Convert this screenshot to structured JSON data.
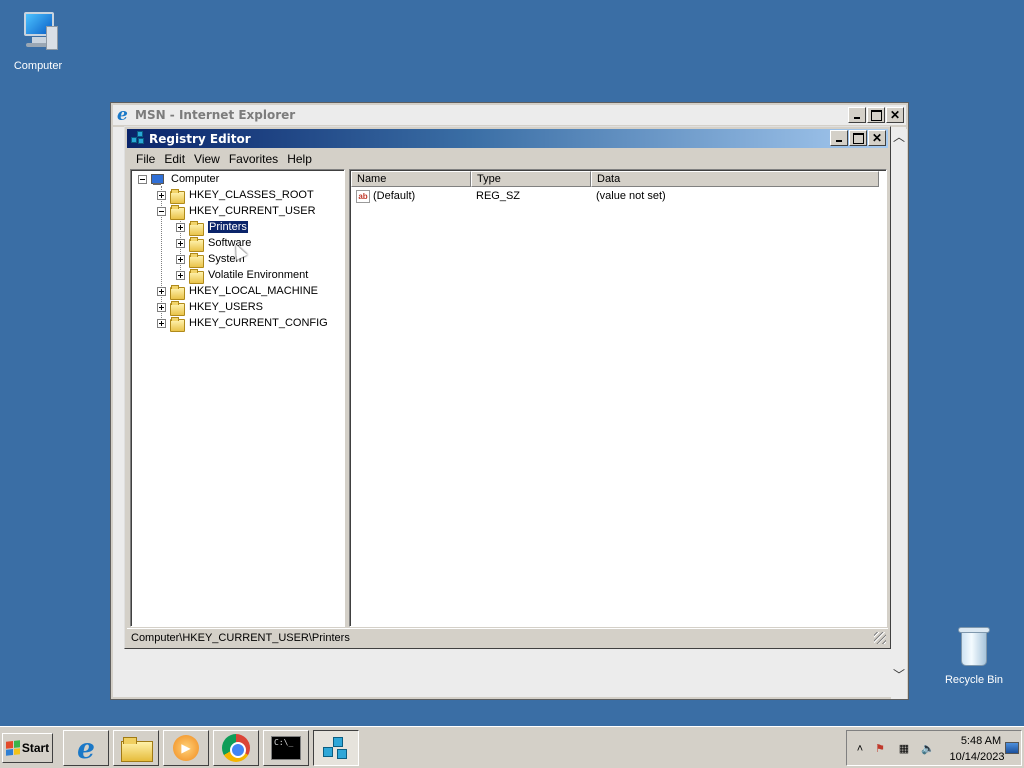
{
  "desktop": {
    "icons": [
      {
        "label": "Computer"
      },
      {
        "label": "Recycle Bin"
      }
    ]
  },
  "ie_window": {
    "title": "MSN - Internet Explorer",
    "icon": "ie-icon"
  },
  "regedit": {
    "title": "Registry Editor",
    "menu": [
      "File",
      "Edit",
      "View",
      "Favorites",
      "Help"
    ],
    "tree": {
      "root": "Computer",
      "keys": [
        {
          "label": "HKEY_CLASSES_ROOT",
          "expanded": false
        },
        {
          "label": "HKEY_CURRENT_USER",
          "expanded": true,
          "children": [
            {
              "label": "Printers",
              "selected": true
            },
            {
              "label": "Software"
            },
            {
              "label": "System"
            },
            {
              "label": "Volatile Environment"
            }
          ]
        },
        {
          "label": "HKEY_LOCAL_MACHINE",
          "expanded": false
        },
        {
          "label": "HKEY_USERS",
          "expanded": false
        },
        {
          "label": "HKEY_CURRENT_CONFIG",
          "expanded": false
        }
      ]
    },
    "list": {
      "columns": [
        "Name",
        "Type",
        "Data"
      ],
      "rows": [
        {
          "name": "(Default)",
          "type": "REG_SZ",
          "data": "(value not set)",
          "icon": "string-value-icon"
        }
      ]
    },
    "status": "Computer\\HKEY_CURRENT_USER\\Printers"
  },
  "taskbar": {
    "start_label": "Start",
    "apps": [
      "ie-icon",
      "explorer-folder-icon",
      "media-player-icon",
      "chrome-icon",
      "cmd-icon",
      "regedit-icon"
    ],
    "active_app": "regedit-icon",
    "clock": {
      "time": "5:48 AM",
      "date": "10/14/2023"
    }
  },
  "colors": {
    "desktop_bg": "#3a6ea5",
    "titlebar_active": "#0a246a",
    "selection": "#0a246a"
  }
}
